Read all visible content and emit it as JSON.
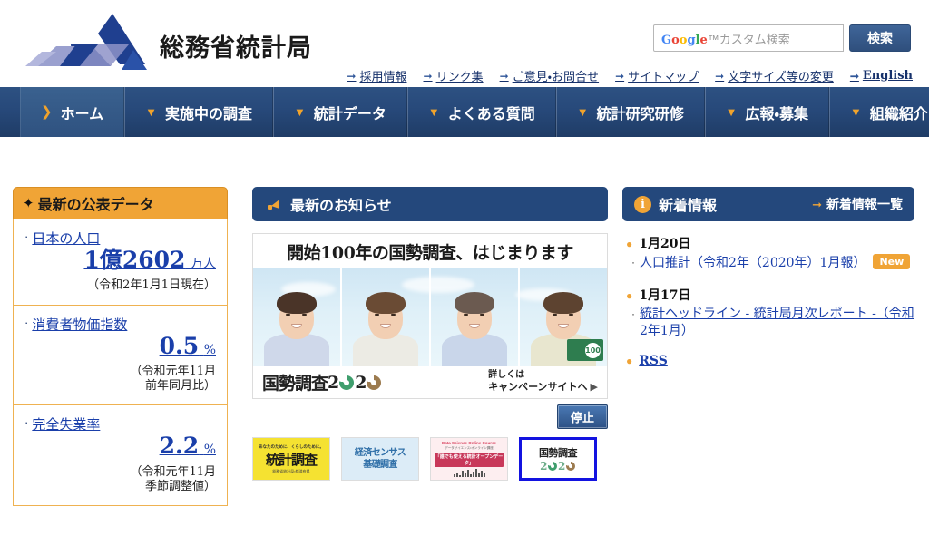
{
  "site": {
    "logo_text": "総務省統計局"
  },
  "search": {
    "placeholder_google": "Google",
    "placeholder_rest": "カスタム検索",
    "value": "",
    "button_label": "検索"
  },
  "util_links": [
    {
      "label": "採用情報"
    },
    {
      "label": "リンク集"
    },
    {
      "label": "ご意見・お問合せ"
    },
    {
      "label": "サイトマップ"
    },
    {
      "label": "文字サイズ等の変更"
    },
    {
      "label": "English"
    }
  ],
  "nav": [
    {
      "label": "ホーム",
      "icon": "chevron-right-icon",
      "active": true
    },
    {
      "label": "実施中の調査",
      "icon": "chevron-down-icon",
      "active": false
    },
    {
      "label": "統計データ",
      "icon": "chevron-down-icon",
      "active": false
    },
    {
      "label": "よくある質問",
      "icon": "chevron-down-icon",
      "active": false
    },
    {
      "label": "統計研究研修",
      "icon": "chevron-down-icon",
      "active": false
    },
    {
      "label": "広報・募集",
      "icon": "chevron-down-icon",
      "active": false
    },
    {
      "label": "組織紹介",
      "icon": "chevron-down-icon",
      "active": false
    }
  ],
  "latest_data": {
    "heading": "最新の公表データ",
    "heading_icon": "star-icon",
    "items": [
      {
        "title": "日本の人口",
        "value": "1億2602",
        "unit": "万人",
        "note": "（令和2年1月1日現在）"
      },
      {
        "title": "消費者物価指数",
        "value": "0.5",
        "unit": "%",
        "note_line1": "（令和元年11月",
        "note_line2": "前年同月比）"
      },
      {
        "title": "完全失業率",
        "value": "2.2",
        "unit": "%",
        "note_line1": "（令和元年11月",
        "note_line2": "季節調整値）"
      }
    ]
  },
  "news_banner": {
    "heading": "最新のお知らせ",
    "heading_icon": "megaphone-icon",
    "banner_title": "開始100年の国勢調査、はじまります",
    "banner_logo_text": "国勢調査",
    "banner_year_2a": "2",
    "banner_year_2b": "2",
    "cta_line1": "詳しくは",
    "cta_line2": "キャンペーンサイトへ",
    "seal_text": "100",
    "stop_button": "停止",
    "thumbnails": [
      {
        "name": "統計調査",
        "top_text": "あなたのために、くらしのために。",
        "main_text": "統計調査",
        "foot_text": "総務省統計局・都道府県",
        "selected": false
      },
      {
        "name": "経済センサス基礎調査",
        "line1": "経済センサス",
        "line2": "基礎調査",
        "selected": false
      },
      {
        "name": "データサイエンス・オンライン講座",
        "top_text": "Data Science Online Course",
        "sub_text": "データサイエンス・オンライン講座",
        "bar_text": "「誰でも使える統計オープンデータ」",
        "selected": false
      },
      {
        "name": "国勢調査2020",
        "main_text": "国勢調査",
        "year_digit": "2",
        "selected": true
      }
    ]
  },
  "new_info": {
    "heading": "新着情報",
    "heading_icon": "info-icon",
    "list_link": "新着情報一覧",
    "entries": [
      {
        "date": "1月20日",
        "title": "人口推計（令和2年（2020年）1月報）",
        "badge": "New"
      },
      {
        "date": "1月17日",
        "title": "統計ヘッドライン - 統計局月次レポート -（令和2年1月）",
        "badge": ""
      }
    ],
    "rss_label": "RSS"
  },
  "colors": {
    "nav_blue": "#27497a",
    "panel_blue": "#24487c",
    "accent_orange": "#f0a436",
    "link_blue": "#1a3faa"
  }
}
